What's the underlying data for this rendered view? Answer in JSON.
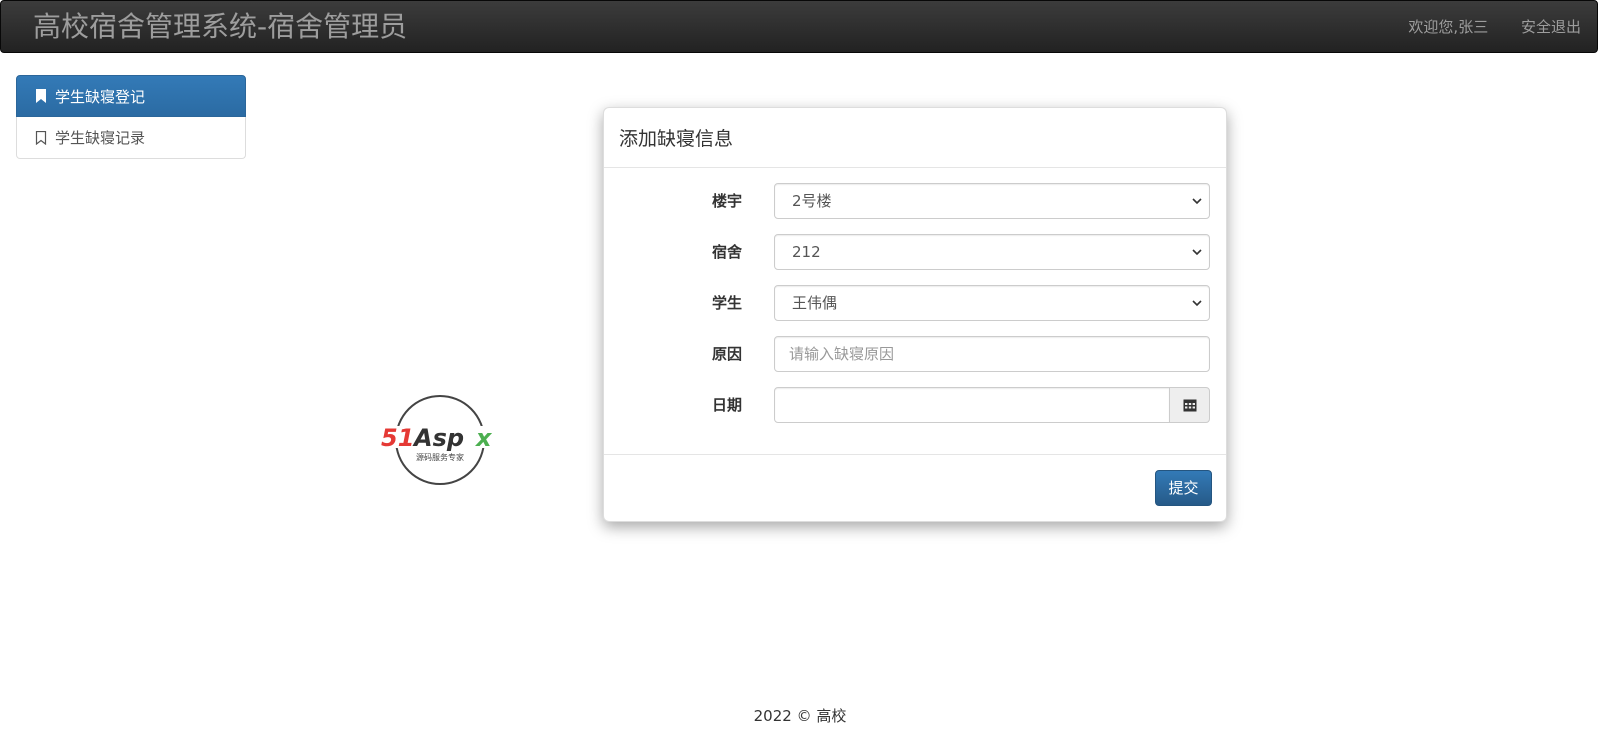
{
  "navbar": {
    "brand": "高校宿舍管理系统-宿舍管理员",
    "welcome": "欢迎您,张三",
    "logout": "安全退出"
  },
  "sidebar": {
    "items": [
      {
        "label": "学生缺寝登记",
        "icon": "bookmark-filled-icon",
        "active": true
      },
      {
        "label": "学生缺寝记录",
        "icon": "bookmark-outline-icon",
        "active": false
      }
    ]
  },
  "logo": {
    "text": "51Aspx",
    "tagline": "源码服务专家"
  },
  "form": {
    "title": "添加缺寝信息",
    "fields": {
      "building": {
        "label": "楼宇",
        "value": "2号楼"
      },
      "room": {
        "label": "宿舍",
        "value": "212"
      },
      "student": {
        "label": "学生",
        "value": "王伟偶"
      },
      "reason": {
        "label": "原因",
        "placeholder": "请输入缺寝原因",
        "value": ""
      },
      "date": {
        "label": "日期",
        "value": "",
        "icon": "calendar-icon"
      }
    },
    "submit_label": "提交"
  },
  "footer": {
    "text": "2022 © 高校"
  },
  "colors": {
    "primary": "#337ab7",
    "navbar": "#222222"
  }
}
